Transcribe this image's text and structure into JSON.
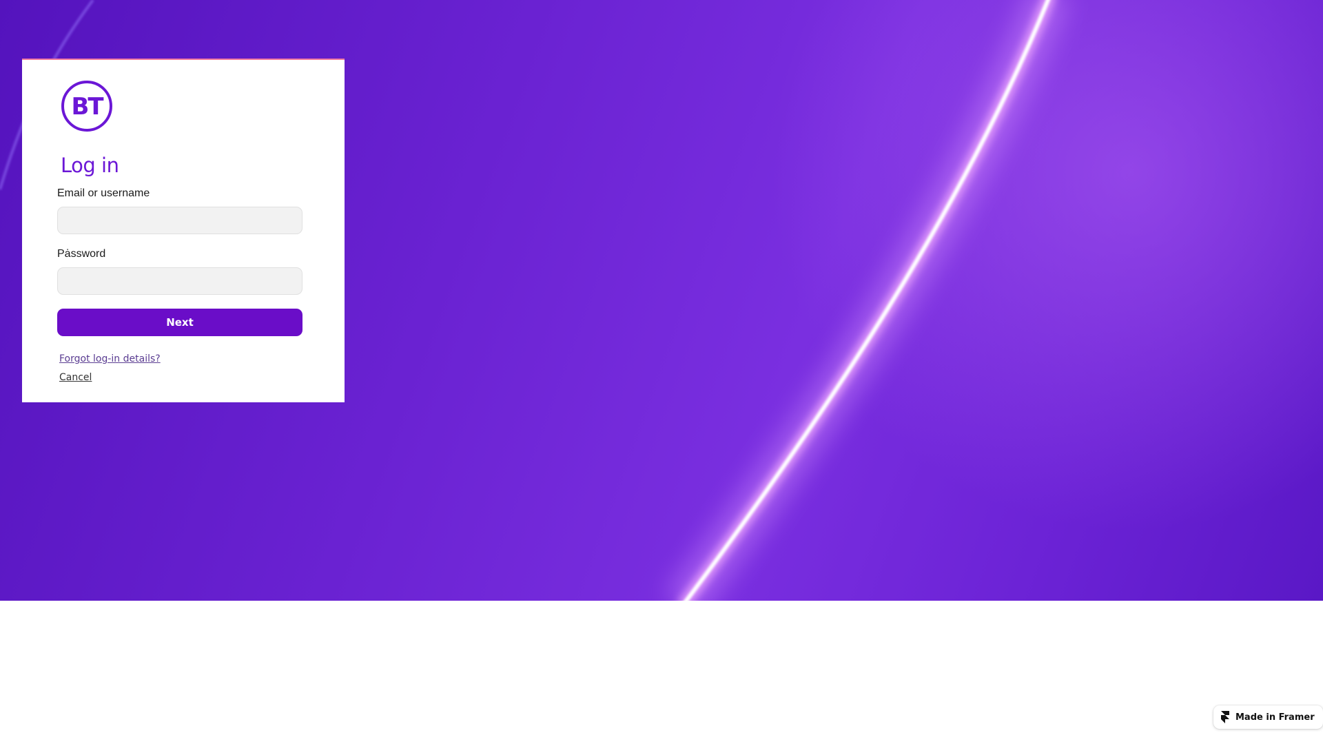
{
  "brand": {
    "logo_text": "BT",
    "logo_color": "#6b17d6",
    "accent_color": "#6a0dc8"
  },
  "login": {
    "title": "Log in",
    "email_label": "Email  or username",
    "email_value": "",
    "email_placeholder": "",
    "password_label": "Pȧssword",
    "password_value": "",
    "password_placeholder": "",
    "next_label": "Next",
    "forgot_link": "Forgot log-in details?",
    "cancel_link": "Cancel"
  },
  "badge": {
    "label": "Made in Framer",
    "icon": "framer-icon"
  }
}
